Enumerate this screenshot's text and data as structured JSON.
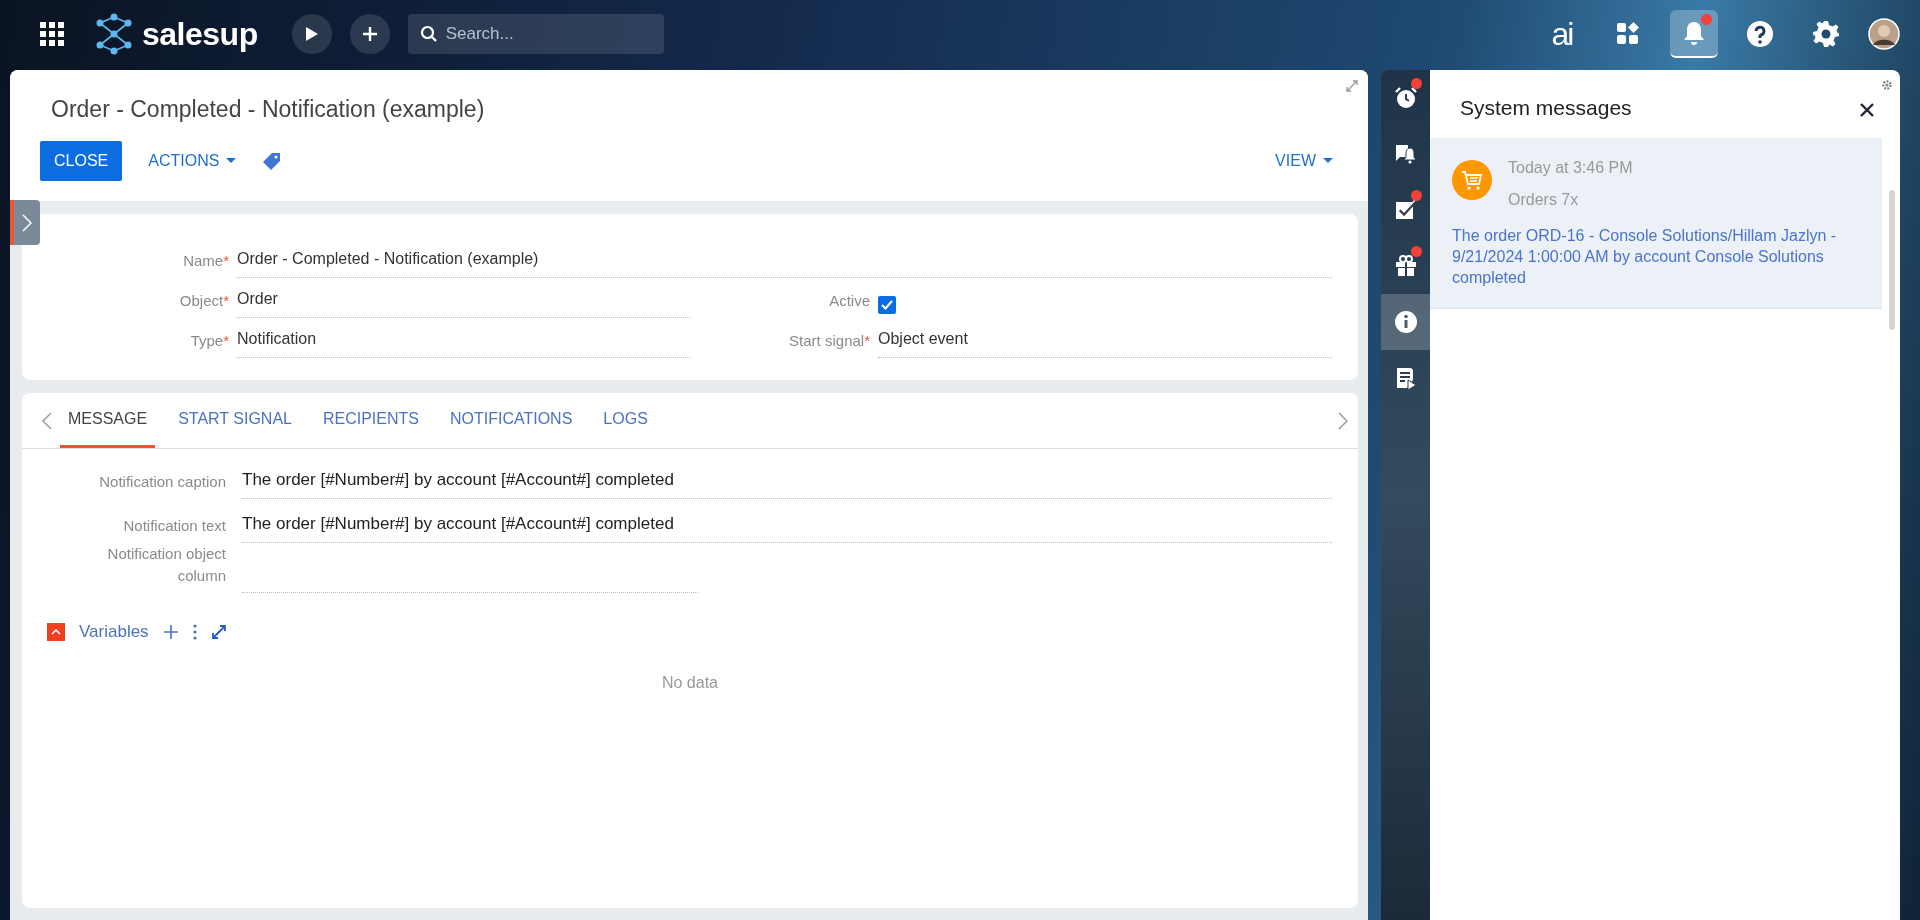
{
  "topbar": {
    "logo": "salesup",
    "search": {
      "placeholder": "Search..."
    },
    "ai_label": "ai",
    "notifications": {
      "selected": true,
      "badge": true
    }
  },
  "record": {
    "title": "Order - Completed - Notification (example)",
    "close_button": "CLOSE",
    "actions_button": "ACTIONS",
    "view_button": "VIEW",
    "fields": [
      {
        "label": "Name",
        "required_mark": "*",
        "value": "Order - Completed - Notification (example)",
        "kind": "wide"
      },
      {
        "label": "Object",
        "required_mark": "*",
        "value": "Order",
        "kind": "text"
      },
      {
        "label": "Active",
        "checked": true,
        "kind": "checkbox"
      },
      {
        "label": "Type",
        "required_mark": "*",
        "value": "Notification",
        "kind": "text"
      },
      {
        "label": "Start signal",
        "required_mark": "*",
        "value": "Object event",
        "kind": "text"
      }
    ],
    "tabs": [
      {
        "label": "MESSAGE",
        "selected": true
      },
      {
        "label": "START SIGNAL",
        "selected": false
      },
      {
        "label": "RECIPIENTS",
        "selected": false
      },
      {
        "label": "NOTIFICATIONS",
        "selected": false
      },
      {
        "label": "LOGS",
        "selected": false
      }
    ],
    "message_fields": [
      {
        "label": "Notification caption",
        "value": "The order [#Number#] by account [#Account#] completed",
        "kind": "wide"
      },
      {
        "label": "Notification text",
        "value": "The order [#Number#] by account [#Account#] completed",
        "kind": "wide"
      },
      {
        "label": "Notification object column",
        "kind": "narrow"
      }
    ],
    "variables": {
      "label": "Variables",
      "expanded": true,
      "empty_text": "No data"
    }
  },
  "side_strip": [
    {
      "kind": "clock",
      "badge": true,
      "selected": false
    },
    {
      "kind": "chat",
      "badge": false,
      "selected": false
    },
    {
      "kind": "task",
      "badge": true,
      "selected": false
    },
    {
      "kind": "gift",
      "badge": true,
      "selected": false
    },
    {
      "kind": "info",
      "badge": false,
      "selected": true
    },
    {
      "kind": "report",
      "badge": false,
      "selected": false
    }
  ],
  "messages_panel": {
    "title": "System messages",
    "messages": [
      {
        "time": "Today at 3:46 PM",
        "group": "Orders 7x",
        "text": "The order ORD-16 - Console Solutions/Hillam Jazlyn - 9/21/2024 1:00:00 AM by account Console Solutions completed",
        "selected": true
      }
    ]
  }
}
